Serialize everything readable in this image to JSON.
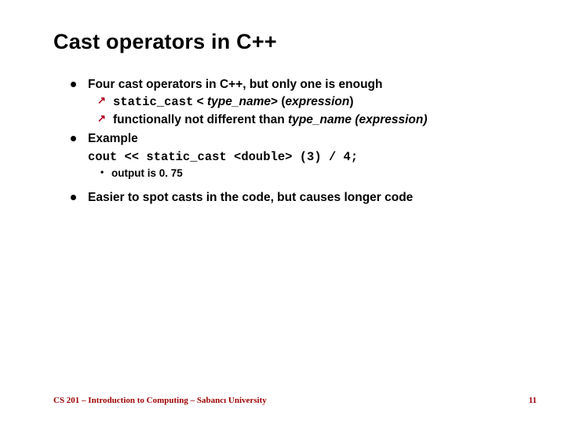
{
  "title": "Cast operators in C++",
  "bullets": {
    "b1": "Four cast operators in C++, but only one is enough",
    "b1a_code": "static_cast",
    "b1a_lt": " < ",
    "b1a_tn": "type_name",
    "b1a_gt": "> (",
    "b1a_expr": "expression",
    "b1a_close": ")",
    "b1b_prefix": "functionally not different than   ",
    "b1b_tn": "type_name (expression)",
    "b2": "Example",
    "b2_code": "cout << static_cast <double> (3) / 4;",
    "b2_out": "output is 0. 75",
    "b3": "Easier to spot casts in the code, but causes longer code"
  },
  "footer": "CS 201 – Introduction to Computing – Sabancı University",
  "page": "11"
}
